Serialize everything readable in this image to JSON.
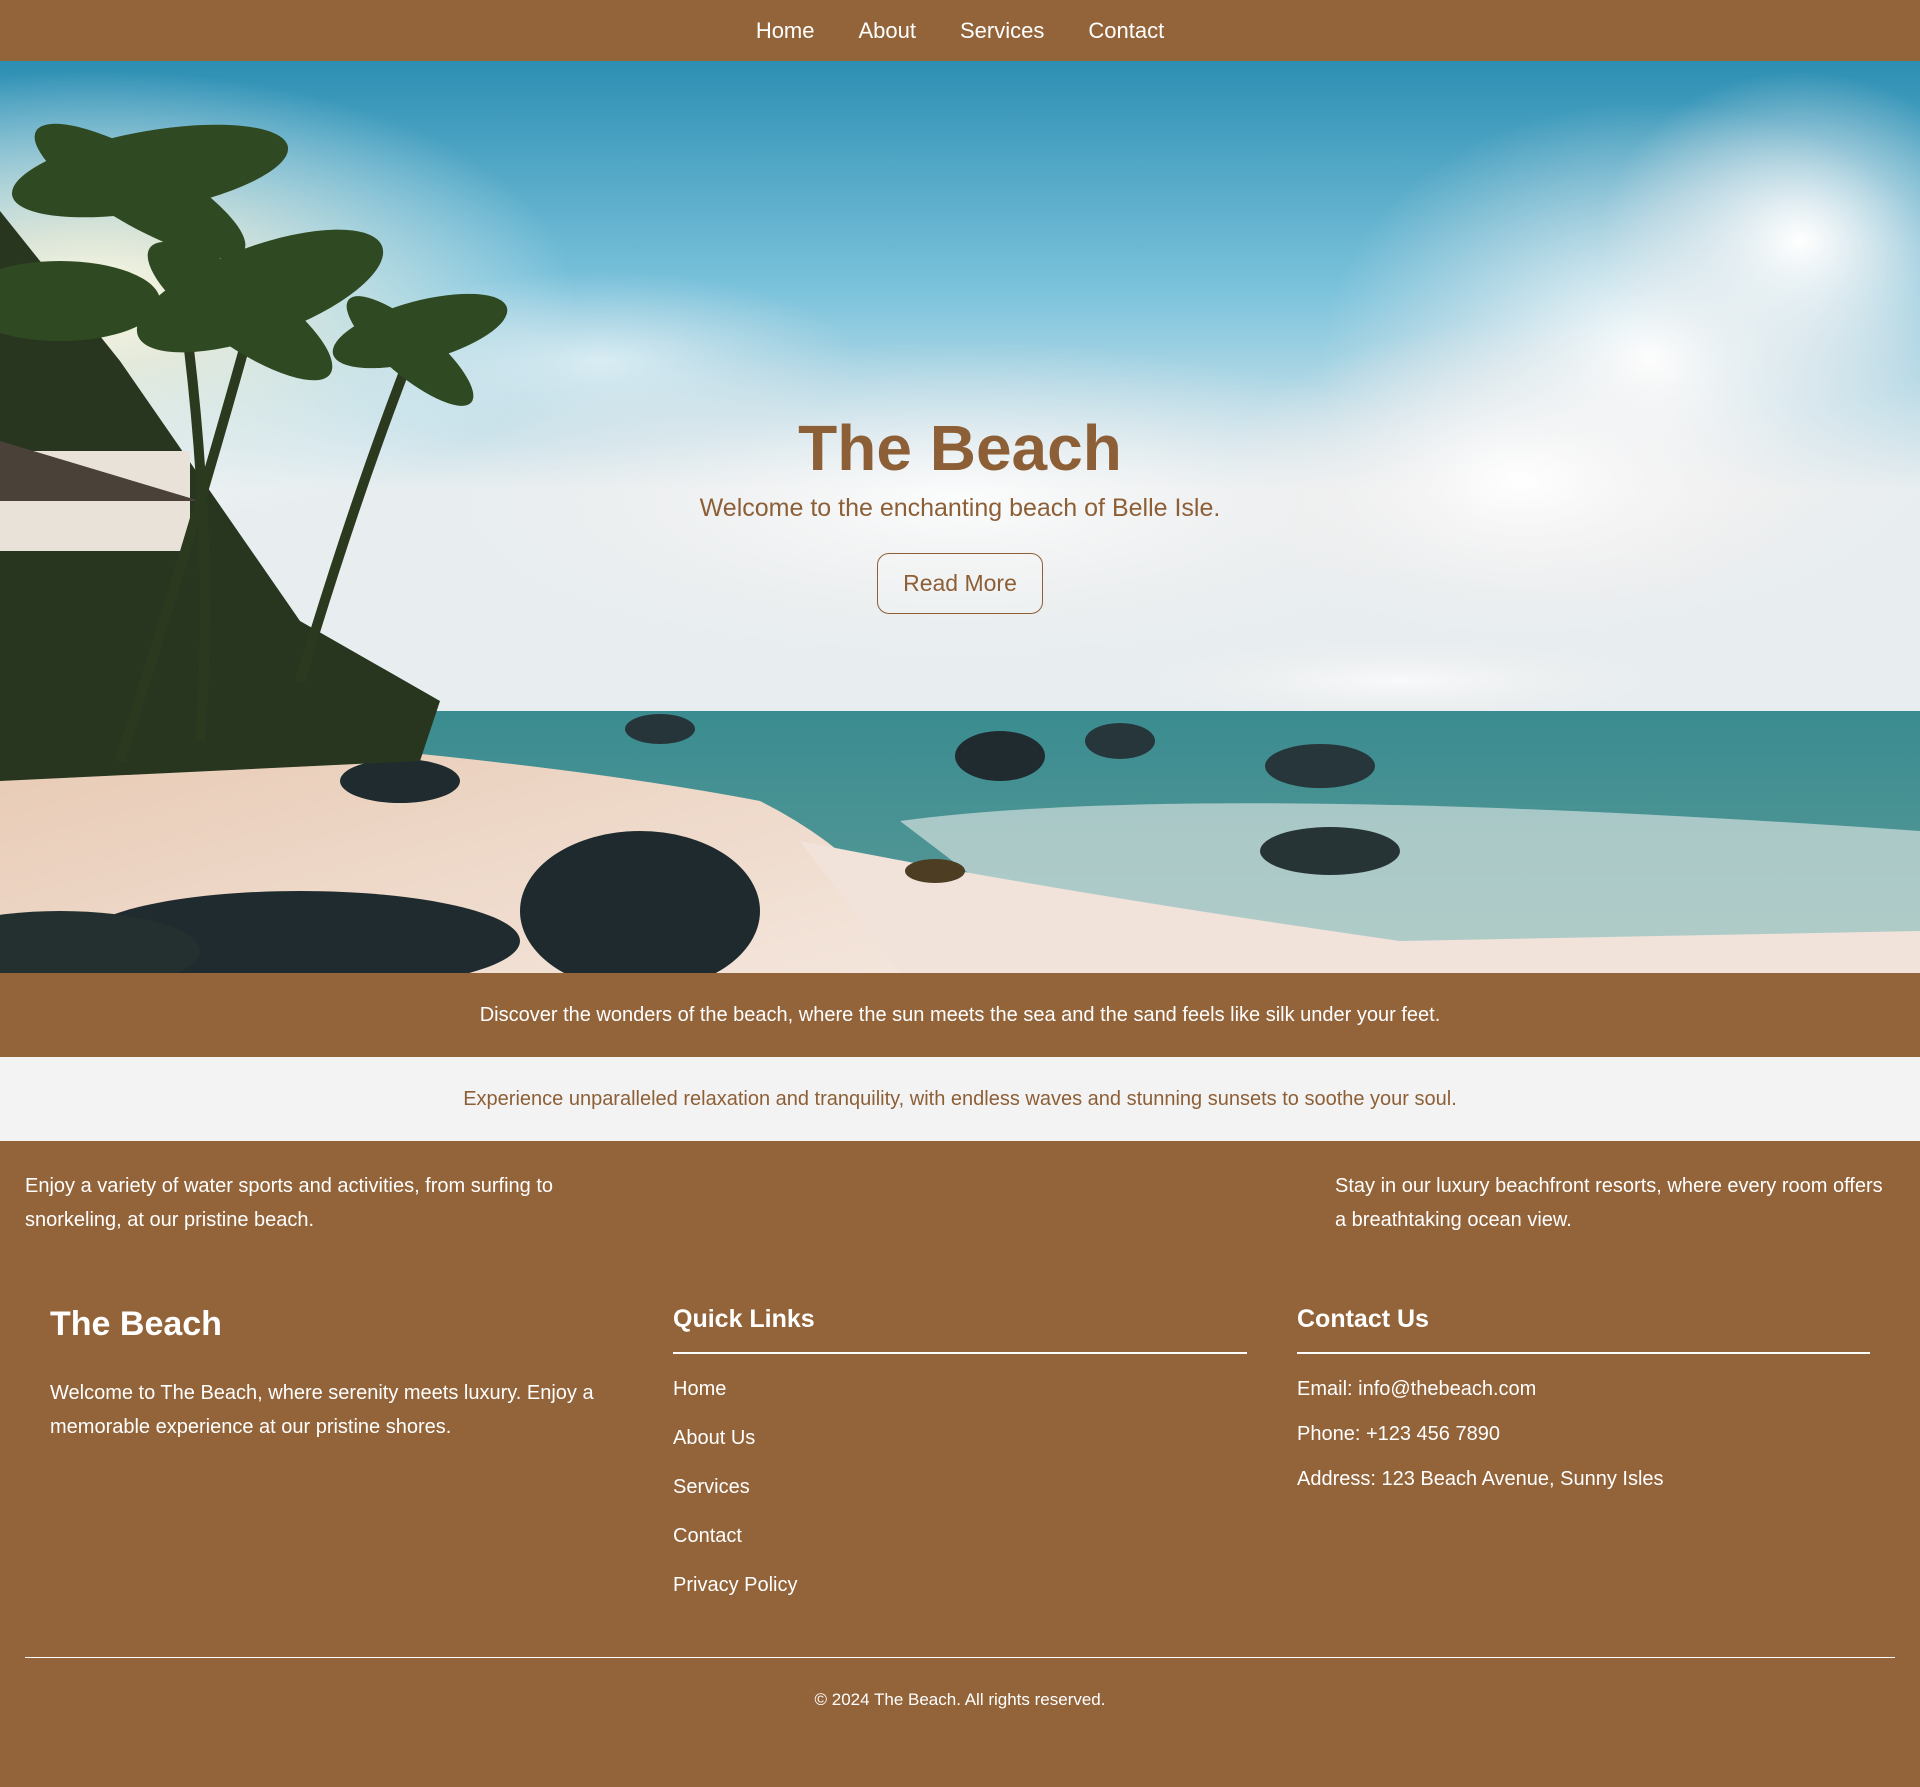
{
  "nav": {
    "items": [
      "Home",
      "About",
      "Services",
      "Contact"
    ]
  },
  "hero": {
    "title": "The Beach",
    "subtitle": "Welcome to the enchanting beach of Belle Isle.",
    "button_label": "Read More"
  },
  "band1": {
    "text": "Discover the wonders of the beach, where the sun meets the sea and the sand feels like silk under your feet."
  },
  "band2": {
    "text": "Experience unparalleled relaxation and tranquility, with endless waves and stunning sunsets to soothe your soul."
  },
  "features": {
    "left": "Enjoy a variety of water sports and activities, from surfing to snorkeling, at our pristine beach.",
    "right": "Stay in our luxury beachfront resorts, where every room offers a breathtaking ocean view."
  },
  "footer": {
    "brand": "The Beach",
    "about": "Welcome to The Beach, where serenity meets luxury. Enjoy a memorable experience at our pristine shores.",
    "quick_links_heading": "Quick Links",
    "quick_links": [
      "Home",
      "About Us",
      "Services",
      "Contact",
      "Privacy Policy"
    ],
    "contact_heading": "Contact Us",
    "email": "Email: info@thebeach.com",
    "phone": "Phone: +123 456 7890",
    "address": "Address: 123 Beach Avenue, Sunny Isles",
    "copyright": "© 2024 The Beach. All rights reserved."
  },
  "colors": {
    "brand_brown": "#93643a",
    "title_brown": "#8d5f36",
    "light_band": "#f3f3f3"
  }
}
